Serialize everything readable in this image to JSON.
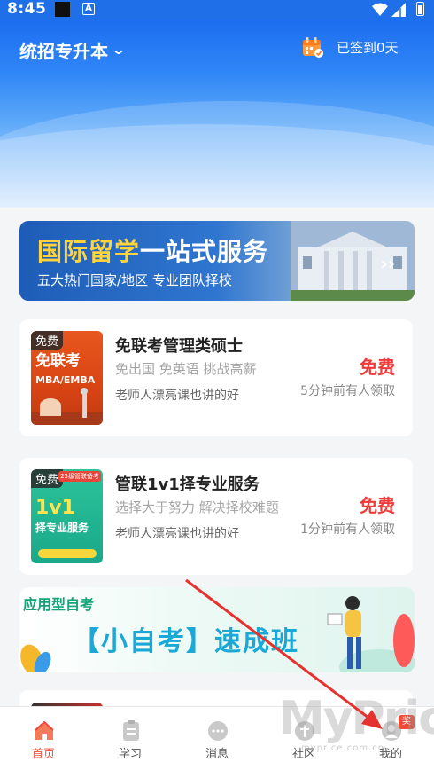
{
  "status_bar": {
    "time": "8:45",
    "a_icon": "A"
  },
  "header": {
    "exam_type": "统招专升本",
    "checkin_text": "已签到0天"
  },
  "banner": {
    "title_highlight": "国际留学",
    "title_rest": "一站式服务",
    "subtitle": "五大热门国家/地区 专业团队择校"
  },
  "cards": [
    {
      "free_tag": "免费",
      "cover_title_1": "免联考",
      "cover_title_2": "MBA/EMBA",
      "title": "免联考管理类硕士",
      "subtitle": "免出国 免英语 挑战高薪",
      "teacher": "老师人漂亮课也讲的好",
      "price": "免费",
      "time": "5分钟前有人领取"
    },
    {
      "free_tag": "免费",
      "cover_title_1": "1v1",
      "cover_title_2": "择专业服务",
      "cover_badge": "25级管联备考",
      "title": "管联1v1择专业服务",
      "subtitle": "选择大于努力 解决择校难题",
      "teacher": "老师人漂亮课也讲的好",
      "price": "免费",
      "time": "1分钟前有人领取"
    }
  ],
  "promo": {
    "top": "应用型自考",
    "main": "【小自考】速成班"
  },
  "tabs": [
    {
      "label": "首页",
      "icon": "home-icon",
      "active": true
    },
    {
      "label": "学习",
      "icon": "clipboard-icon",
      "active": false
    },
    {
      "label": "消息",
      "icon": "chat-bubble-icon",
      "active": false
    },
    {
      "label": "社区",
      "icon": "community-icon",
      "active": false
    },
    {
      "label": "我的",
      "icon": "profile-icon",
      "active": false,
      "badge": "奖"
    }
  ],
  "watermark": {
    "text": "MyPrice",
    "small": "myprice.com.cn"
  },
  "colors": {
    "primary_blue": "#1f6fe8",
    "price_red": "#f03a3a",
    "active_tab": "#f04a3a"
  }
}
